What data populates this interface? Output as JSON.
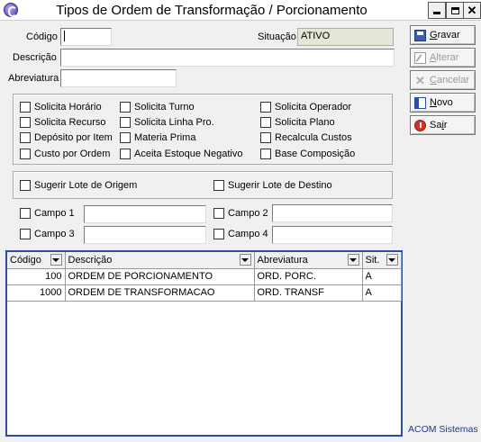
{
  "window": {
    "title": "Tipos de Ordem de Transformação / Porcionamento"
  },
  "form": {
    "codigo_label": "Código",
    "codigo_value": "",
    "situacao_label": "Situação",
    "situacao_value": "ATIVO",
    "descricao_label": "Descrição",
    "descricao_value": "",
    "abreviatura_label": "Abreviatura",
    "abreviatura_value": ""
  },
  "options": {
    "solicita_horario": "Solicita Horário",
    "solicita_turno": "Solicita Turno",
    "solicita_operador": "Solicita Operador",
    "solicita_recurso": "Solicita Recurso",
    "solicita_linha": "Solicita Linha Pro.",
    "solicita_plano": "Solicita Plano",
    "deposito_por_item": "Depósito por Item",
    "materia_prima": "Materia Prima",
    "recalcula_custos": "Recalcula Custos",
    "custo_por_ordem": "Custo por Ordem",
    "aceita_estoque_negativo": "Aceita Estoque Negativo",
    "base_composicao": "Base Composição"
  },
  "lote": {
    "sugerir_origem": "Sugerir Lote de Origem",
    "sugerir_destino": "Sugerir Lote de Destino"
  },
  "campos": {
    "campo1_label": "Campo 1",
    "campo1_value": "",
    "campo2_label": "Campo 2",
    "campo2_value": "",
    "campo3_label": "Campo 3",
    "campo3_value": "",
    "campo4_label": "Campo 4",
    "campo4_value": ""
  },
  "toolbar": {
    "gravar_pre": "",
    "gravar_ul": "G",
    "gravar_post": "ravar",
    "alterar_pre": "",
    "alterar_ul": "A",
    "alterar_post": "lterar",
    "cancelar_pre": "",
    "cancelar_ul": "C",
    "cancelar_post": "ancelar",
    "novo_pre": "",
    "novo_ul": "N",
    "novo_post": "ovo",
    "sair_pre": "Sa",
    "sair_ul": "i",
    "sair_post": "r"
  },
  "table": {
    "headers": {
      "codigo": "Código",
      "descricao": "Descrição",
      "abreviatura": "Abreviatura",
      "sit": "Sit."
    },
    "rows": [
      {
        "codigo": "100",
        "descricao": "ORDEM DE PORCIONAMENTO",
        "abreviatura": "ORD. PORC.",
        "sit": "A"
      },
      {
        "codigo": "1000",
        "descricao": "ORDEM DE TRANSFORMACAO",
        "abreviatura": "ORD. TRANSF",
        "sit": "A"
      }
    ]
  },
  "footer": {
    "brand": "ACOM Sistemas"
  }
}
